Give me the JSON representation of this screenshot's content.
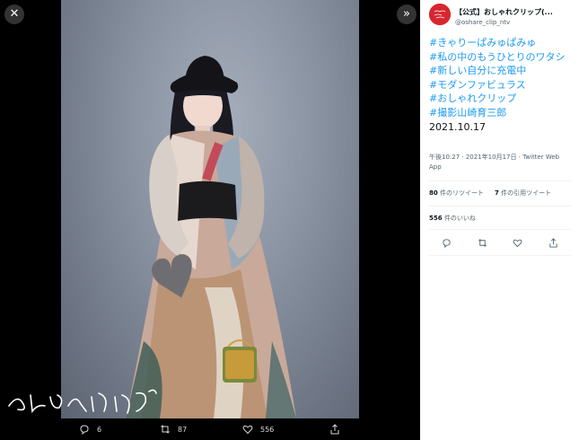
{
  "viewer": {
    "close_icon": "close-icon",
    "expand_icon": "double-chevron-right-icon",
    "watermark": "おしゃれクリップ",
    "actions": {
      "reply": {
        "icon": "reply-icon",
        "count": "6"
      },
      "retweet": {
        "icon": "retweet-icon",
        "count": "87"
      },
      "like": {
        "icon": "heart-icon",
        "count": "556"
      },
      "share": {
        "icon": "share-icon"
      }
    }
  },
  "tweet": {
    "avatar_text": "おしゃれクリップ",
    "display_name": "【公式】おしゃれクリップ(...",
    "handle": "@oshare_clip_ntv",
    "hashtags": [
      "#きゃりーぱみゅぱみゅ",
      "#私の中のもうひとりのワタシ",
      "#新しい自分に充電中",
      "#モダンファビュラス",
      "#おしゃれクリップ",
      "#撮影山崎育三郎"
    ],
    "date_text": "2021.10.17",
    "timestamp": "午後10:27 · 2021年10月17日 · Twitter Web App",
    "retweets": {
      "count": "80",
      "label": "件のリツイート"
    },
    "quotes": {
      "count": "7",
      "label": "件の引用ツイート"
    },
    "likes": {
      "count": "556",
      "label": "件のいいね"
    }
  },
  "colors": {
    "accent": "#1d9bf0",
    "brand": "#d8262f",
    "text": "#0f1419",
    "muted": "#536471"
  }
}
